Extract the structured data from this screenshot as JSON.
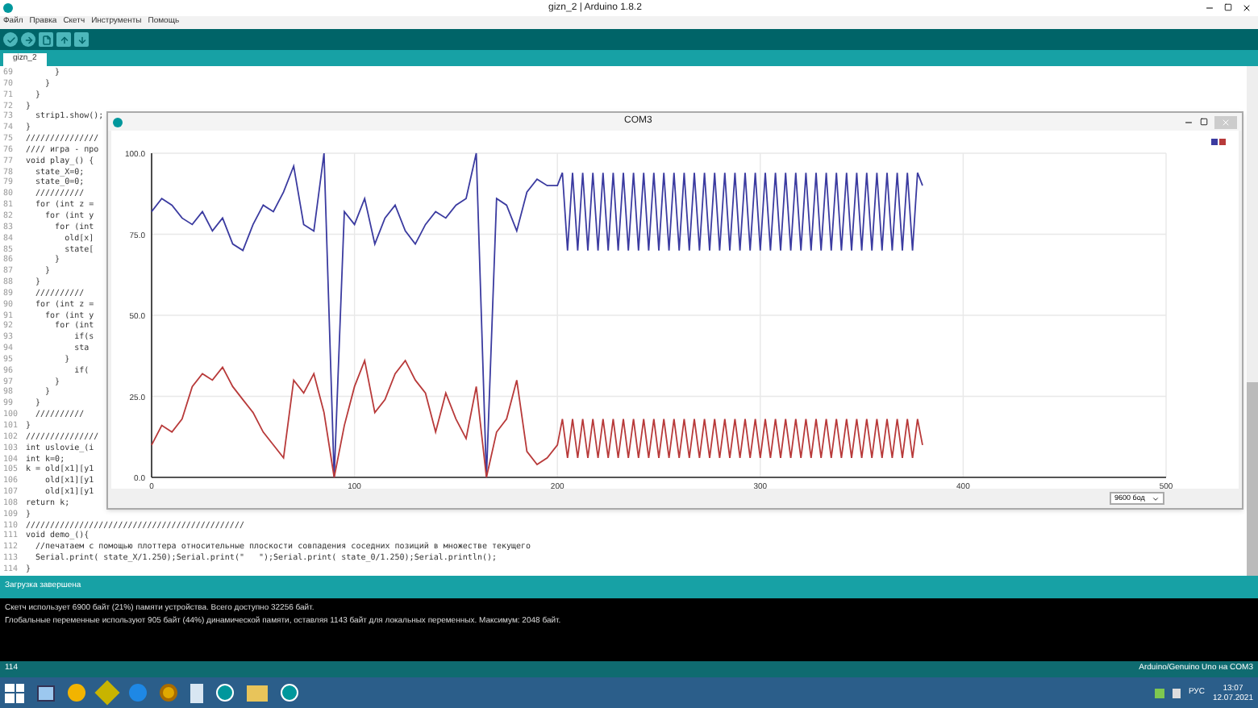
{
  "window": {
    "title": "gizn_2 | Arduino 1.8.2"
  },
  "menu": [
    "Файл",
    "Правка",
    "Скетч",
    "Инструменты",
    "Помощь"
  ],
  "tabs": [
    {
      "label": "gizn_2",
      "selected": true
    }
  ],
  "editor": {
    "lines": [
      {
        "number": "69",
        "text": "      }"
      },
      {
        "number": "70",
        "text": "    }"
      },
      {
        "number": "71",
        "text": "  }"
      },
      {
        "number": "72",
        "text": "}"
      },
      {
        "number": "73",
        "text": "  strip1.show();"
      },
      {
        "number": "74",
        "text": "}"
      },
      {
        "number": "75",
        "text": "///////////////"
      },
      {
        "number": "76",
        "text": "//// игра - про"
      },
      {
        "number": "77",
        "text": "void play_() {"
      },
      {
        "number": "78",
        "text": "  state_X=0;"
      },
      {
        "number": "79",
        "text": "  state_0=0;"
      },
      {
        "number": "80",
        "text": "  //////////"
      },
      {
        "number": "81",
        "text": "  for (int z ="
      },
      {
        "number": "82",
        "text": "    for (int y"
      },
      {
        "number": "83",
        "text": "      for (int"
      },
      {
        "number": "84",
        "text": "        old[x]"
      },
      {
        "number": "85",
        "text": "        state["
      },
      {
        "number": "86",
        "text": "      }"
      },
      {
        "number": "87",
        "text": "    }"
      },
      {
        "number": "88",
        "text": "  }"
      },
      {
        "number": "89",
        "text": "  //////////"
      },
      {
        "number": "90",
        "text": "  for (int z ="
      },
      {
        "number": "91",
        "text": "    for (int y"
      },
      {
        "number": "92",
        "text": "      for (int"
      },
      {
        "number": "93",
        "text": "          if(s"
      },
      {
        "number": "94",
        "text": "          sta"
      },
      {
        "number": "95",
        "text": "        }"
      },
      {
        "number": "96",
        "text": "          if("
      },
      {
        "number": "97",
        "text": "      }"
      },
      {
        "number": "98",
        "text": "    }"
      },
      {
        "number": "99",
        "text": "  }"
      },
      {
        "number": "100",
        "text": "  //////////"
      },
      {
        "number": "101",
        "text": "}"
      },
      {
        "number": "102",
        "text": "///////////////"
      },
      {
        "number": "103",
        "text": "int uslovie_(i"
      },
      {
        "number": "104",
        "text": "int k=0;"
      },
      {
        "number": "105",
        "text": "k = old[x1][y1"
      },
      {
        "number": "106",
        "text": "    old[x1][y1"
      },
      {
        "number": "107",
        "text": "    old[x1][y1"
      },
      {
        "number": "108",
        "text": "return k;"
      },
      {
        "number": "109",
        "text": "}"
      },
      {
        "number": "110",
        "text": "/////////////////////////////////////////////"
      },
      {
        "number": "111",
        "text": "void demo_(){"
      },
      {
        "number": "112",
        "text": "  //печатаем с помощью плоттера относительные плоскости совпадения соседних позиций в множестве текущего"
      },
      {
        "number": "113",
        "text": "  Serial.print( state_X/1.250);Serial.print(\"   \");Serial.print( state_0/1.250);Serial.println();"
      },
      {
        "number": "114",
        "text": "}"
      }
    ]
  },
  "plotter": {
    "title": "COM3",
    "baud": "9600 бод",
    "chart_data": {
      "type": "line",
      "x": [
        0,
        5,
        10,
        15,
        20,
        25,
        30,
        35,
        40,
        45,
        50,
        55,
        60,
        65,
        70,
        75,
        80,
        85,
        90,
        95,
        100,
        105,
        110,
        115,
        120,
        125,
        130,
        135,
        140,
        145,
        150,
        155,
        160,
        165,
        170,
        175,
        180,
        185,
        190,
        195,
        200,
        202.5,
        205,
        207.5,
        210,
        212.5,
        215,
        217.5,
        220,
        222.5,
        225,
        227.5,
        230,
        232.5,
        235,
        237.5,
        240,
        242.5,
        245,
        247.5,
        250,
        252.5,
        255,
        257.5,
        260,
        262.5,
        265,
        267.5,
        270,
        272.5,
        275,
        277.5,
        280,
        282.5,
        285,
        287.5,
        290,
        292.5,
        295,
        297.5,
        300,
        302.5,
        305,
        307.5,
        310,
        312.5,
        315,
        317.5,
        320,
        322.5,
        325,
        327.5,
        330,
        332.5,
        335,
        337.5,
        340,
        342.5,
        345,
        347.5,
        350,
        352.5,
        355,
        357.5,
        360,
        362.5,
        365,
        367.5,
        370,
        372.5,
        375,
        377.5,
        380
      ],
      "series": [
        {
          "color": "#3b3ba0",
          "values": [
            82,
            86,
            84,
            80,
            78,
            82,
            76,
            80,
            72,
            70,
            78,
            84,
            82,
            88,
            96,
            78,
            76,
            100,
            0,
            82,
            78,
            86,
            72,
            80,
            84,
            76,
            72,
            78,
            82,
            80,
            84,
            86,
            100,
            0,
            86,
            84,
            76,
            88,
            92,
            90,
            90,
            94,
            70,
            94,
            70,
            94,
            70,
            94,
            70,
            94,
            70,
            94,
            70,
            94,
            70,
            94,
            70,
            94,
            70,
            94,
            70,
            94,
            70,
            94,
            70,
            94,
            70,
            94,
            70,
            94,
            70,
            94,
            70,
            94,
            70,
            94,
            70,
            94,
            70,
            94,
            70,
            94,
            70,
            94,
            70,
            94,
            70,
            94,
            70,
            94,
            70,
            94,
            70,
            94,
            70,
            94,
            70,
            94,
            70,
            94,
            70,
            94,
            70,
            94,
            70,
            94,
            70,
            94,
            70,
            94,
            70,
            94,
            90
          ]
        },
        {
          "color": "#b83a3a",
          "values": [
            10,
            16,
            14,
            18,
            28,
            32,
            30,
            34,
            28,
            24,
            20,
            14,
            10,
            6,
            30,
            26,
            32,
            20,
            0,
            16,
            28,
            36,
            20,
            24,
            32,
            36,
            30,
            26,
            14,
            26,
            18,
            12,
            28,
            0,
            14,
            18,
            30,
            8,
            4,
            6,
            10,
            18,
            6,
            18,
            6,
            18,
            6,
            18,
            6,
            18,
            6,
            18,
            6,
            18,
            6,
            18,
            6,
            18,
            6,
            18,
            6,
            18,
            6,
            18,
            6,
            18,
            6,
            18,
            6,
            18,
            6,
            18,
            6,
            18,
            6,
            18,
            6,
            18,
            6,
            18,
            6,
            18,
            6,
            18,
            6,
            18,
            6,
            18,
            6,
            18,
            6,
            18,
            6,
            18,
            6,
            18,
            6,
            18,
            6,
            18,
            6,
            18,
            6,
            18,
            6,
            18,
            6,
            18,
            6,
            18,
            6,
            18,
            10
          ]
        }
      ],
      "xlim": [
        0,
        500
      ],
      "ylim": [
        0,
        100
      ],
      "grid": true,
      "xticks": [
        0,
        100,
        200,
        300,
        400,
        500
      ],
      "yticks": [
        {
          "value": 0,
          "label": "0.0"
        },
        {
          "value": 25,
          "label": "25.0"
        },
        {
          "value": 50,
          "label": "50.0"
        },
        {
          "value": 75,
          "label": "75.0"
        },
        {
          "value": 100,
          "label": "100.0"
        }
      ]
    }
  },
  "console": {
    "header": "Загрузка завершена",
    "lines": [
      "Скетч использует 6900 байт (21%) памяти устройства. Всего доступно 32256 байт.",
      "Глобальные переменные используют 905 байт (44%) динамической памяти, оставляя 1143 байт для локальных переменных. Максимум: 2048 байт."
    ]
  },
  "status_bar": {
    "line": "114",
    "board": "Arduino/Genuino Uno на COM3"
  },
  "taskbar": {
    "language": "РУС",
    "time": "13:07",
    "date": "12.07.2021"
  }
}
